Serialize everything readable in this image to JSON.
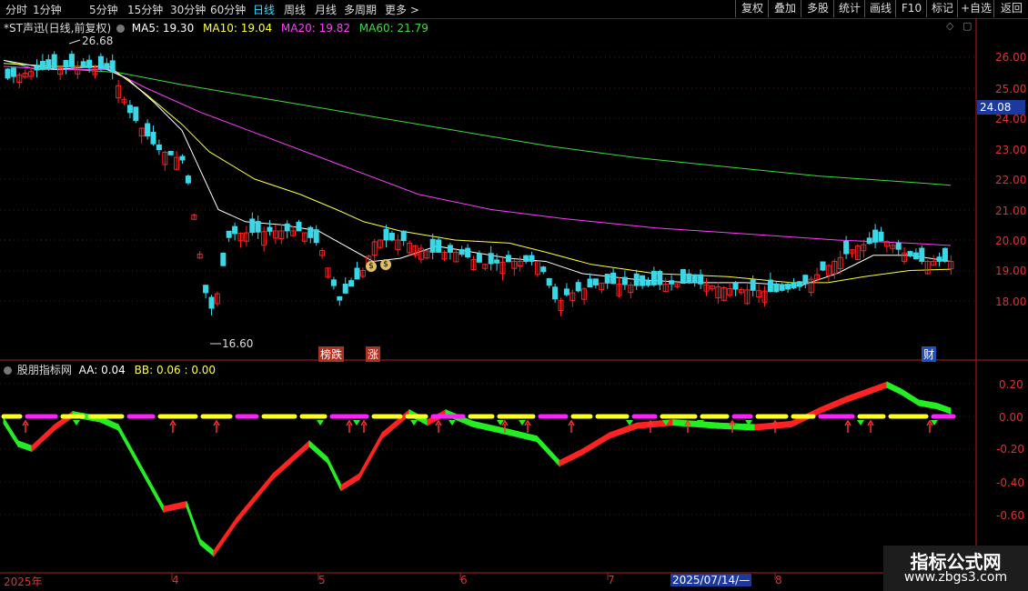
{
  "toolbar": {
    "periods": [
      "分时",
      "1分钟",
      "5分钟",
      "15分钟",
      "30分钟",
      "60分钟",
      "日线",
      "周线",
      "月线",
      "多周期",
      "更多 >"
    ],
    "active_period": "日线",
    "right_buttons": [
      "复权",
      "叠加",
      "多股",
      "统计",
      "画线",
      "F10",
      "标记",
      "+自选",
      "返回"
    ]
  },
  "main_chart": {
    "title": "*ST声迅(日线,前复权)",
    "ma": [
      {
        "label": "MA5: 19.30",
        "color": "#ffffff"
      },
      {
        "label": "MA10: 19.04",
        "color": "#ffff3c"
      },
      {
        "label": "MA20: 19.82",
        "color": "#ff3cff"
      },
      {
        "label": "MA60: 21.79",
        "color": "#3cdc3c"
      }
    ],
    "high_label": "26.68",
    "low_label": "16.60",
    "current_price": "24.08",
    "event_labels": [
      "榜跌",
      "涨",
      "财"
    ],
    "y_ticks": [
      "26.00",
      "25.00",
      "24.00",
      "23.00",
      "22.00",
      "21.00",
      "20.00",
      "19.00",
      "18.00"
    ]
  },
  "indicator": {
    "title": "股朋指标网",
    "aa": "AA: 0.04",
    "bb": "BB: 0.06 : 0.00",
    "y_ticks": [
      "0.20",
      "0.00",
      "-0.20",
      "-0.40",
      "-0.60"
    ]
  },
  "dates": [
    "2025年",
    "4",
    "5",
    "6",
    "7",
    "8"
  ],
  "cursor_date": "2025/07/14/—",
  "watermark": {
    "line1": "指标公式网",
    "line2": "www.zbgs3.com"
  },
  "chart_data": {
    "type": "candlestick",
    "title": "*ST声迅(日线,前复权)",
    "ylim": [
      16.6,
      26.68
    ],
    "high": 26.68,
    "low": 16.6,
    "last_price": 24.08,
    "ma": {
      "MA5": 19.3,
      "MA10": 19.04,
      "MA20": 19.82,
      "MA60": 21.79
    },
    "indicator": {
      "name": "股朋指标网",
      "AA": 0.04,
      "BB": 0.06,
      "ylim": [
        -0.6,
        0.2
      ]
    },
    "x_labels": [
      "2025年",
      "4",
      "5",
      "6",
      "7",
      "8"
    ]
  }
}
